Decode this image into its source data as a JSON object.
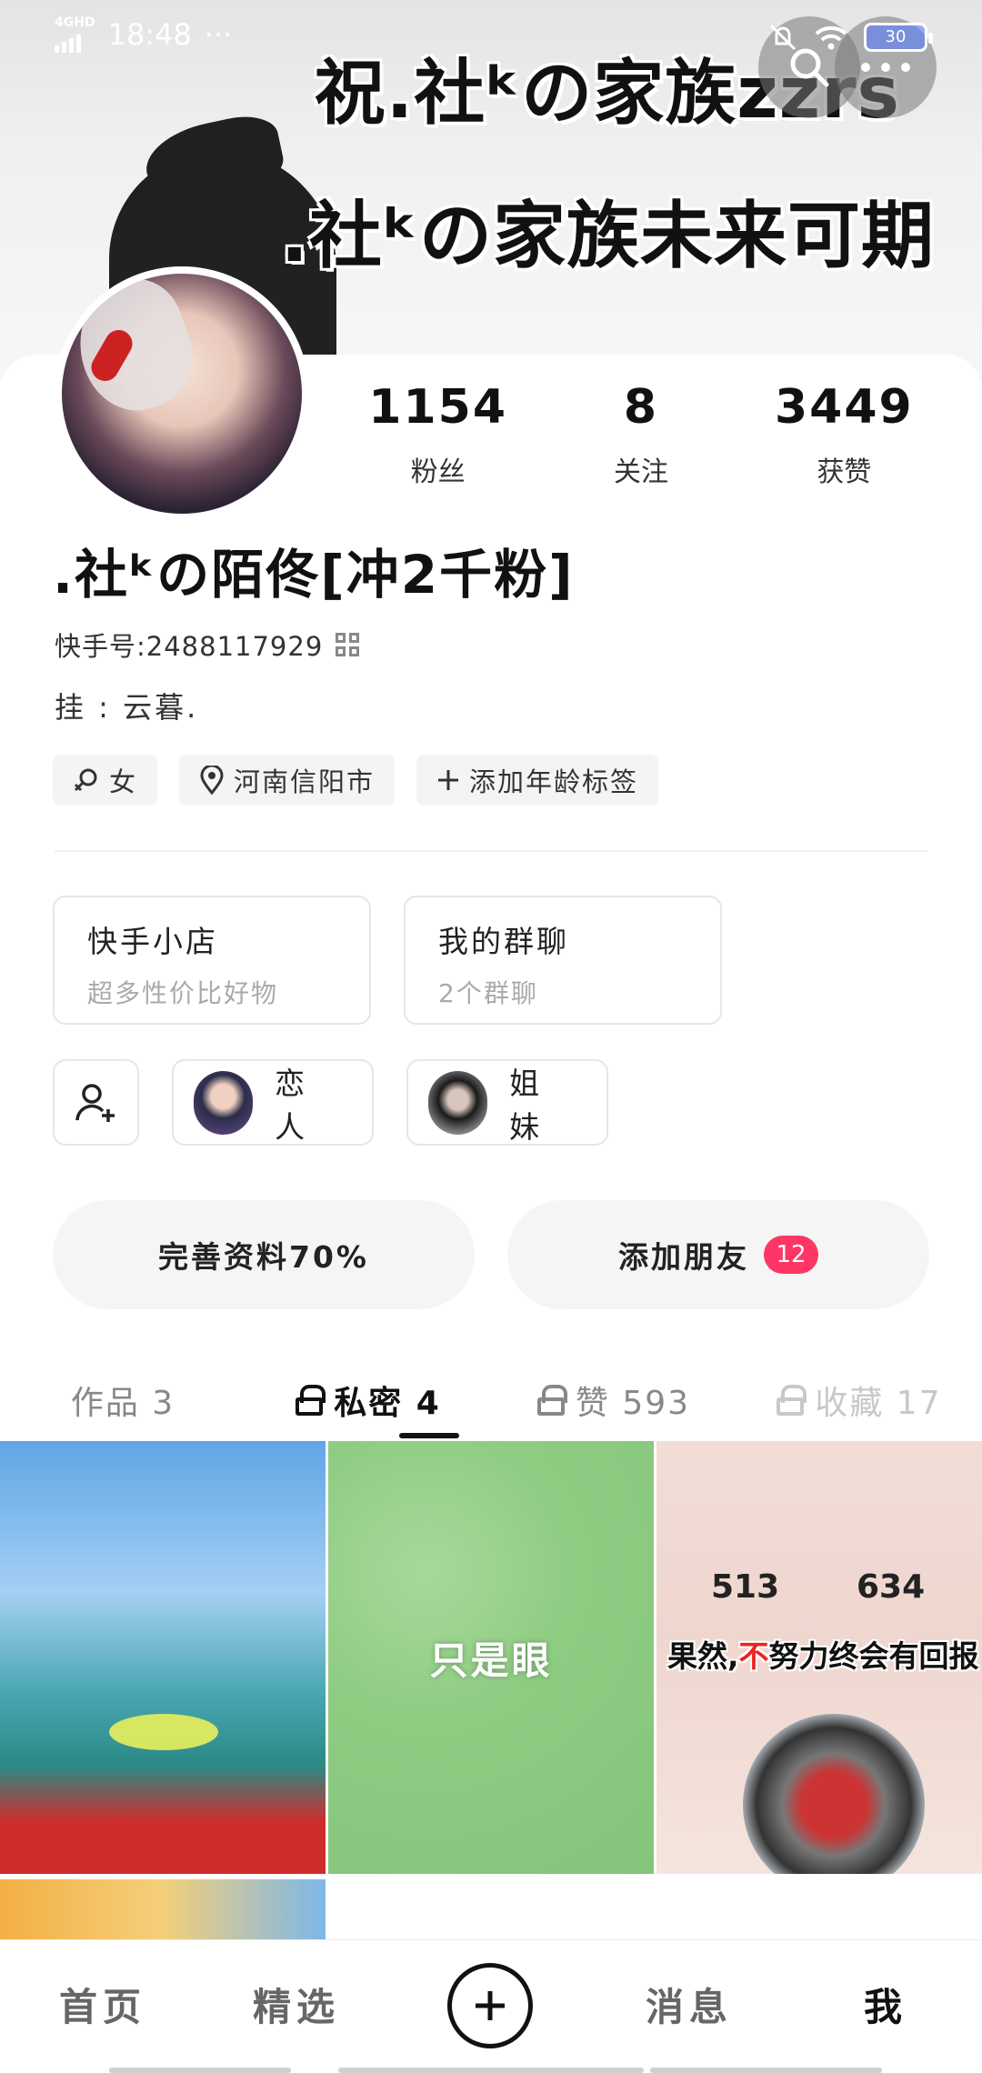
{
  "status_bar": {
    "network": "4GHD",
    "time": "18:48",
    "dots": "···",
    "battery": "30"
  },
  "banner": {
    "line1": "祝.社ᵏの家族zzrs",
    "line2": ".社ᵏの家族未来可期"
  },
  "profile": {
    "name": ".社ᵏの陌佟[冲2千粉]",
    "kuaishou_id": "快手号:2488117929",
    "bio": "挂 : 云暮.",
    "stats": [
      {
        "num": "1154",
        "label": "粉丝"
      },
      {
        "num": "8",
        "label": "关注"
      },
      {
        "num": "3449",
        "label": "获赞"
      }
    ],
    "tags": [
      {
        "icon": "female-icon",
        "text": "女"
      },
      {
        "icon": "location-icon",
        "text": "河南信阳市"
      },
      {
        "icon": "plus-icon",
        "text": "添加年龄标签"
      }
    ]
  },
  "shops": [
    {
      "title": "快手小店",
      "sub": "超多性价比好物"
    },
    {
      "title": "我的群聊",
      "sub": "2个群聊"
    }
  ],
  "relations": [
    {
      "label": "恋人"
    },
    {
      "label": "姐妹"
    }
  ],
  "actions": {
    "complete_profile": "完善资料70%",
    "add_friend": "添加朋友",
    "add_friend_badge": "12"
  },
  "tabs": [
    {
      "label": "作品 3",
      "locked": false
    },
    {
      "label": "私密 4",
      "locked": true
    },
    {
      "label": "赞 593",
      "locked": true
    },
    {
      "label": "收藏 17",
      "locked": true
    }
  ],
  "grid": {
    "c2_text": "只是眼",
    "c3_stat1": "513",
    "c3_stat2": "634",
    "c3_caption_a": "果然,",
    "c3_caption_red": "不",
    "c3_caption_b": "努力终会有回报"
  },
  "nav": {
    "home": "首页",
    "featured": "精选",
    "messages": "消息",
    "me": "我"
  },
  "colors": {
    "accent": "#fe3666",
    "text": "#111111",
    "muted": "#888888"
  }
}
